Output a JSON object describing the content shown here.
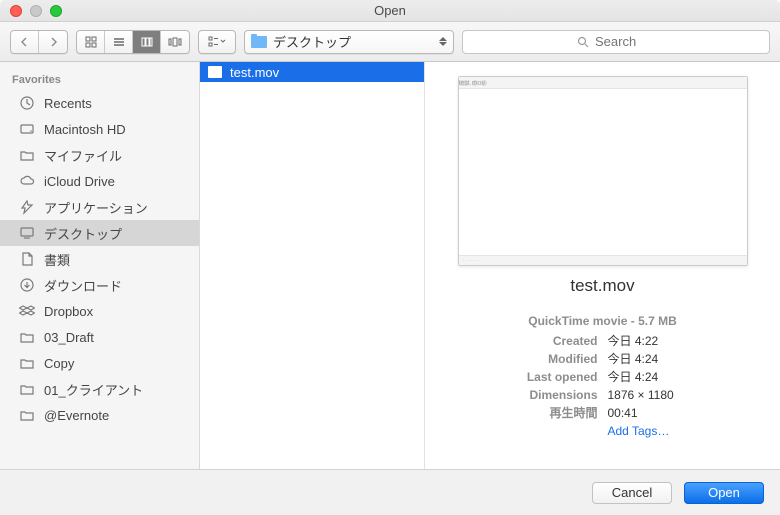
{
  "window": {
    "title": "Open"
  },
  "toolbar": {
    "location_label": "デスクトップ",
    "search_placeholder": "Search"
  },
  "sidebar": {
    "section": "Favorites",
    "items": [
      {
        "icon": "clock-icon",
        "label": "Recents"
      },
      {
        "icon": "hdd-icon",
        "label": "Macintosh HD"
      },
      {
        "icon": "folder-icon",
        "label": "マイファイル"
      },
      {
        "icon": "cloud-icon",
        "label": "iCloud Drive"
      },
      {
        "icon": "apps-icon",
        "label": "アプリケーション"
      },
      {
        "icon": "desktop-icon",
        "label": "デスクトップ",
        "selected": true
      },
      {
        "icon": "doc-icon",
        "label": "書類"
      },
      {
        "icon": "download-icon",
        "label": "ダウンロード"
      },
      {
        "icon": "dropbox-icon",
        "label": "Dropbox"
      },
      {
        "icon": "folder-icon",
        "label": "03_Draft"
      },
      {
        "icon": "folder-icon",
        "label": "Copy"
      },
      {
        "icon": "folder-icon",
        "label": "01_クライアント"
      },
      {
        "icon": "folder-icon",
        "label": "@Evernote"
      }
    ]
  },
  "files": [
    {
      "name": "test.mov",
      "selected": true
    }
  ],
  "preview": {
    "filename": "test.mov",
    "kind_size": "QuickTime movie - 5.7 MB",
    "rows": [
      {
        "k": "Created",
        "v": "今日 4:22"
      },
      {
        "k": "Modified",
        "v": "今日 4:24"
      },
      {
        "k": "Last opened",
        "v": "今日 4:24"
      },
      {
        "k": "Dimensions",
        "v": "1876 × 1180"
      },
      {
        "k": "再生時間",
        "v": "00:41"
      }
    ],
    "tags_label": "Add Tags…"
  },
  "footer": {
    "cancel": "Cancel",
    "open": "Open"
  }
}
